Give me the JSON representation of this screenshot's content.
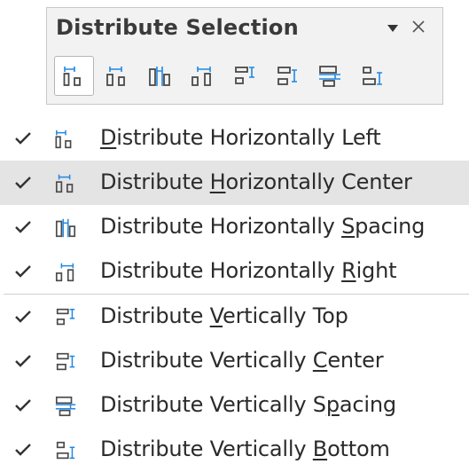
{
  "toolbar": {
    "title": "Distribute Selection",
    "icons": [
      "distribute-horizontally-left-icon",
      "distribute-horizontally-center-icon",
      "distribute-horizontally-spacing-icon",
      "distribute-horizontally-right-icon",
      "distribute-vertically-top-icon",
      "distribute-vertically-center-icon",
      "distribute-vertically-spacing-icon",
      "distribute-vertically-bottom-icon"
    ]
  },
  "menu": {
    "items": [
      {
        "pre": "",
        "mnemonic": "D",
        "post": "istribute Horizontally Left",
        "checked": true
      },
      {
        "pre": "Distribute ",
        "mnemonic": "H",
        "post": "orizontally Center",
        "checked": true
      },
      {
        "pre": "Distribute Horizontally ",
        "mnemonic": "S",
        "post": "pacing",
        "checked": true
      },
      {
        "pre": "Distribute Horizontally ",
        "mnemonic": "R",
        "post": "ight",
        "checked": true
      },
      {
        "pre": "Distribute ",
        "mnemonic": "V",
        "post": "ertically Top",
        "checked": true
      },
      {
        "pre": "Distribute Vertically ",
        "mnemonic": "C",
        "post": "enter",
        "checked": true
      },
      {
        "pre": "Distribute Vertically S",
        "mnemonic": "p",
        "post": "acing",
        "checked": true
      },
      {
        "pre": "Distribute Vertically ",
        "mnemonic": "B",
        "post": "ottom",
        "checked": true
      }
    ]
  },
  "colors": {
    "icon_dark": "#4a4a4a",
    "icon_accent": "#1e88e5",
    "highlight": "#e4e4e4",
    "panel": "#f2f2f2"
  }
}
